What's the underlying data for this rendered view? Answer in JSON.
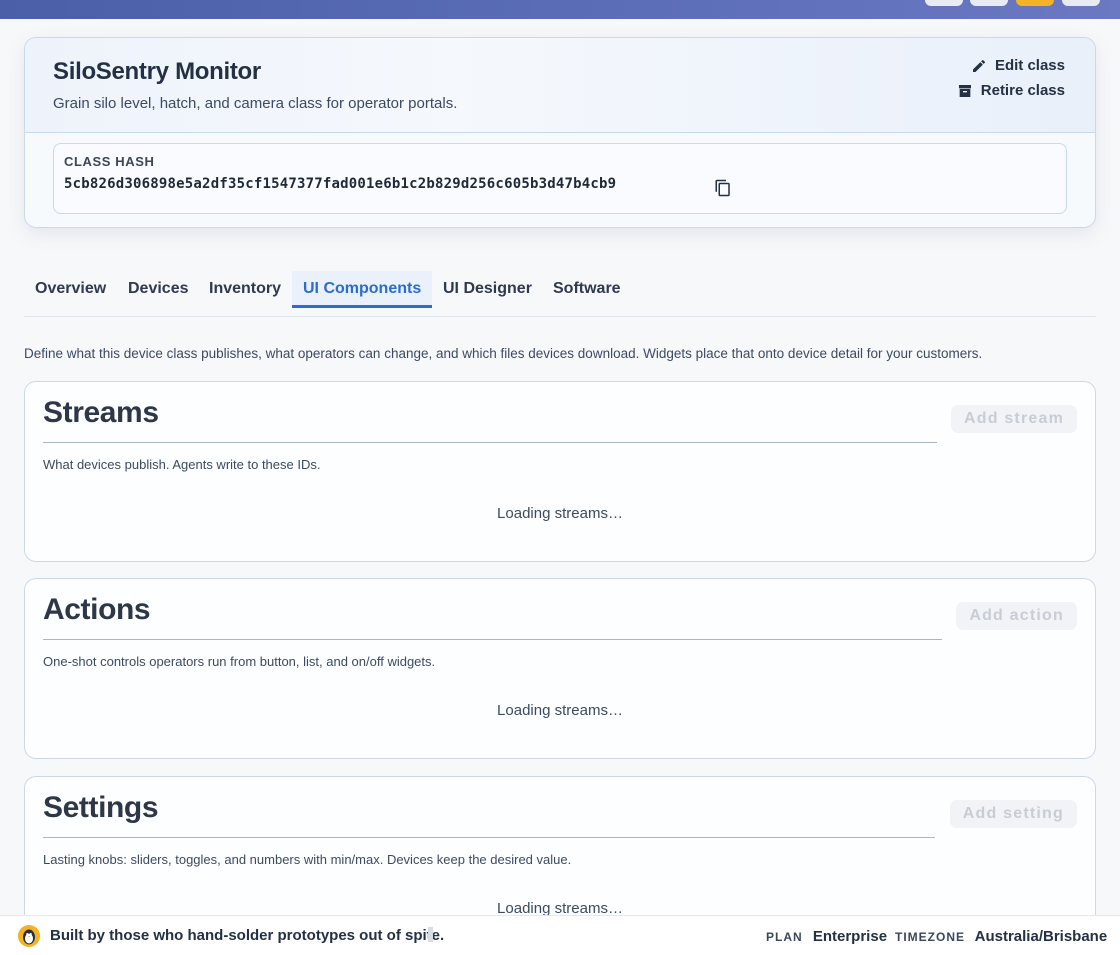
{
  "class": {
    "title": "SiloSentry Monitor",
    "subtitle": "Grain silo level, hatch, and camera class for operator portals.",
    "edit_label": "Edit class",
    "retire_label": "Retire class",
    "hash_label": "CLASS HASH",
    "hash_value": "5cb826d306898e5a2df35cf1547377fad001e6b1c2b829d256c605b3d47b4cb9"
  },
  "tabs": [
    {
      "label": "Overview"
    },
    {
      "label": "Devices"
    },
    {
      "label": "Inventory"
    },
    {
      "label": "UI Components",
      "active": true
    },
    {
      "label": "UI Designer"
    },
    {
      "label": "Software"
    }
  ],
  "intro": "Define what this device class publishes, what operators can change, and which files devices download. Widgets place that onto device detail for your customers.",
  "sections": {
    "streams": {
      "title": "Streams",
      "description": "What devices publish. Agents write to these IDs.",
      "button": "Add stream",
      "loading": "Loading streams…"
    },
    "actions": {
      "title": "Actions",
      "description": "One-shot controls operators run from button, list, and on/off widgets.",
      "button": "Add action",
      "loading": "Loading streams…"
    },
    "settings": {
      "title": "Settings",
      "description": "Lasting knobs: sliders, toggles, and numbers with min/max. Devices keep the desired value.",
      "button": "Add setting",
      "loading": "Loading streams…"
    }
  },
  "footer": {
    "tagline": "Built by those who hand-solder prototypes out of spite.",
    "plan_label": "PLAN",
    "plan_value": "Enterprise",
    "timezone_label": "TIMEZONE",
    "timezone_value": "Australia/Brisbane"
  },
  "colors": {
    "accent": "#2b6cd1",
    "topbar": "#5a6cb6",
    "logo": "#f4b225"
  }
}
